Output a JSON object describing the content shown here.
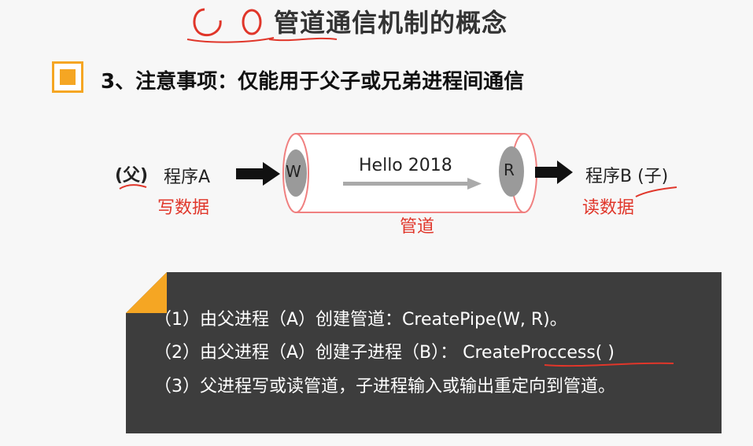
{
  "header": {
    "title": "管道通信机制的概念",
    "section_title": "3、注意事项：仅能用于父子或兄弟进程间通信"
  },
  "diagram": {
    "parent_label_prefix": "(父)",
    "program_a": "程序A",
    "write_data": "写数据",
    "pipe_text": "Hello 2018",
    "pipe_label": "管道",
    "write_end": "W",
    "read_end": "R",
    "program_b": "程序B (子)",
    "read_data": "读数据"
  },
  "notes": {
    "line1": "（1）由父进程（A）创建管道：CreatePipe(W, R)。",
    "line2": "（2）由父进程（A）创建子进程（B）：  CreateProccess( )",
    "line3": "（3）父进程写或读管道，子进程输入或输出重定向到管道。"
  },
  "colors": {
    "accent": "#f5a623",
    "annotation_red": "#e0362a",
    "panel_bg": "#3d3d3d"
  }
}
